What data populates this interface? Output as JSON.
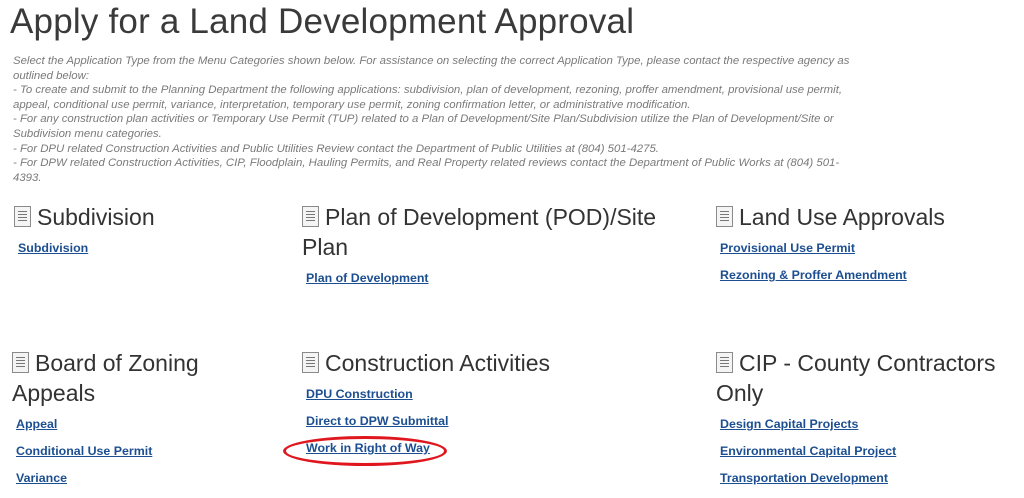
{
  "page": {
    "title": "Apply for a Land Development Approval"
  },
  "instructions": [
    "Select the Application Type from the Menu Categories shown below. For assistance on selecting the correct Application Type, please contact the respective agency as outlined below:",
    "- To create and submit to the Planning Department the following applications: subdivision, plan of development, rezoning, proffer amendment, provisional use permit, appeal, conditional use permit, variance, interpretation, temporary use permit, zoning confirmation letter, or administrative modification.",
    "- For any construction plan activities or Temporary Use Permit (TUP) related to a Plan of Development/Site Plan/Subdivision utilize the Plan of Development/Site or Subdivision menu categories.",
    "- For DPU related Construction Activities and Public Utilities Review contact the Department of Public Utilities at (804) 501-4275.",
    "- For DPW related Construction Activities, CIP, Floodplain, Hauling Permits, and Real Property related reviews contact the Department of Public Works at (804) 501-4393."
  ],
  "categories": [
    {
      "title": "Subdivision",
      "icon": "document-icon",
      "links": [
        "Subdivision"
      ]
    },
    {
      "title": "Plan of Development (POD)/Site Plan",
      "icon": "document-icon",
      "links": [
        "Plan of Development"
      ]
    },
    {
      "title": "Land Use Approvals",
      "icon": "document-icon",
      "links": [
        "Provisional Use Permit",
        "Rezoning & Proffer Amendment"
      ]
    },
    {
      "title": "Board of Zoning Appeals",
      "icon": "document-icon",
      "links": [
        "Appeal",
        "Conditional Use Permit",
        "Variance"
      ]
    },
    {
      "title": "Construction Activities",
      "icon": "document-icon",
      "links": [
        "DPU Construction",
        "Direct to DPW Submittal",
        "Work in Right of Way"
      ]
    },
    {
      "title": "CIP - County Contractors Only",
      "icon": "document-icon",
      "links": [
        "Design Capital Projects",
        "Environmental Capital Project",
        "Transportation Development"
      ]
    }
  ],
  "annotation": {
    "color": "#e0161e"
  }
}
